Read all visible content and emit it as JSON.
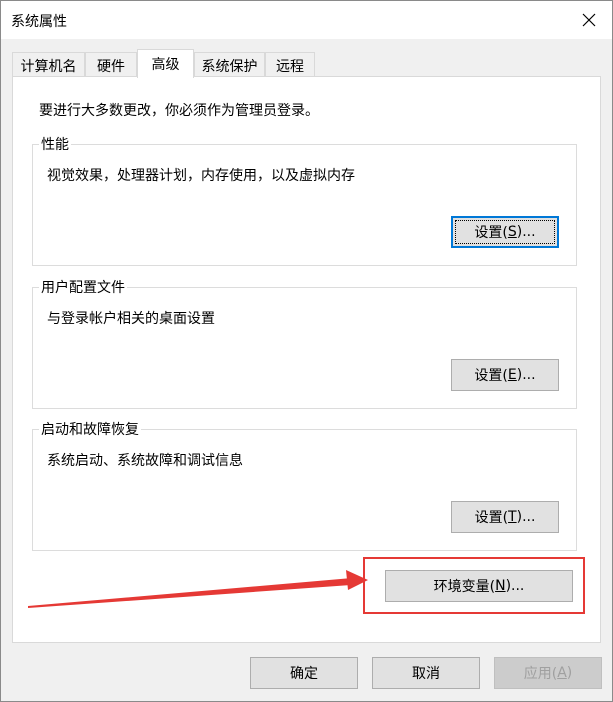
{
  "window": {
    "title": "系统属性"
  },
  "tabs": [
    {
      "label": "计算机名"
    },
    {
      "label": "硬件"
    },
    {
      "label": "高级"
    },
    {
      "label": "系统保护"
    },
    {
      "label": "远程"
    }
  ],
  "panel": {
    "admin_note": "要进行大多数更改，你必须作为管理员登录。",
    "performance": {
      "title": "性能",
      "desc": "视觉效果，处理器计划，内存使用，以及虚拟内存",
      "button": {
        "prefix": "设置(",
        "key": "S",
        "suffix": ")..."
      }
    },
    "user_profiles": {
      "title": "用户配置文件",
      "desc": "与登录帐户相关的桌面设置",
      "button": {
        "prefix": "设置(",
        "key": "E",
        "suffix": ")..."
      }
    },
    "startup_recovery": {
      "title": "启动和故障恢复",
      "desc": "系统启动、系统故障和调试信息",
      "button": {
        "prefix": "设置(",
        "key": "T",
        "suffix": ")..."
      }
    },
    "env_button": {
      "prefix": "环境变量(",
      "key": "N",
      "suffix": ")..."
    }
  },
  "footer": {
    "ok": "确定",
    "cancel": "取消",
    "apply": {
      "prefix": "应用(",
      "key": "A",
      "suffix": ")"
    }
  },
  "annotation": {
    "color": "#e53935"
  }
}
